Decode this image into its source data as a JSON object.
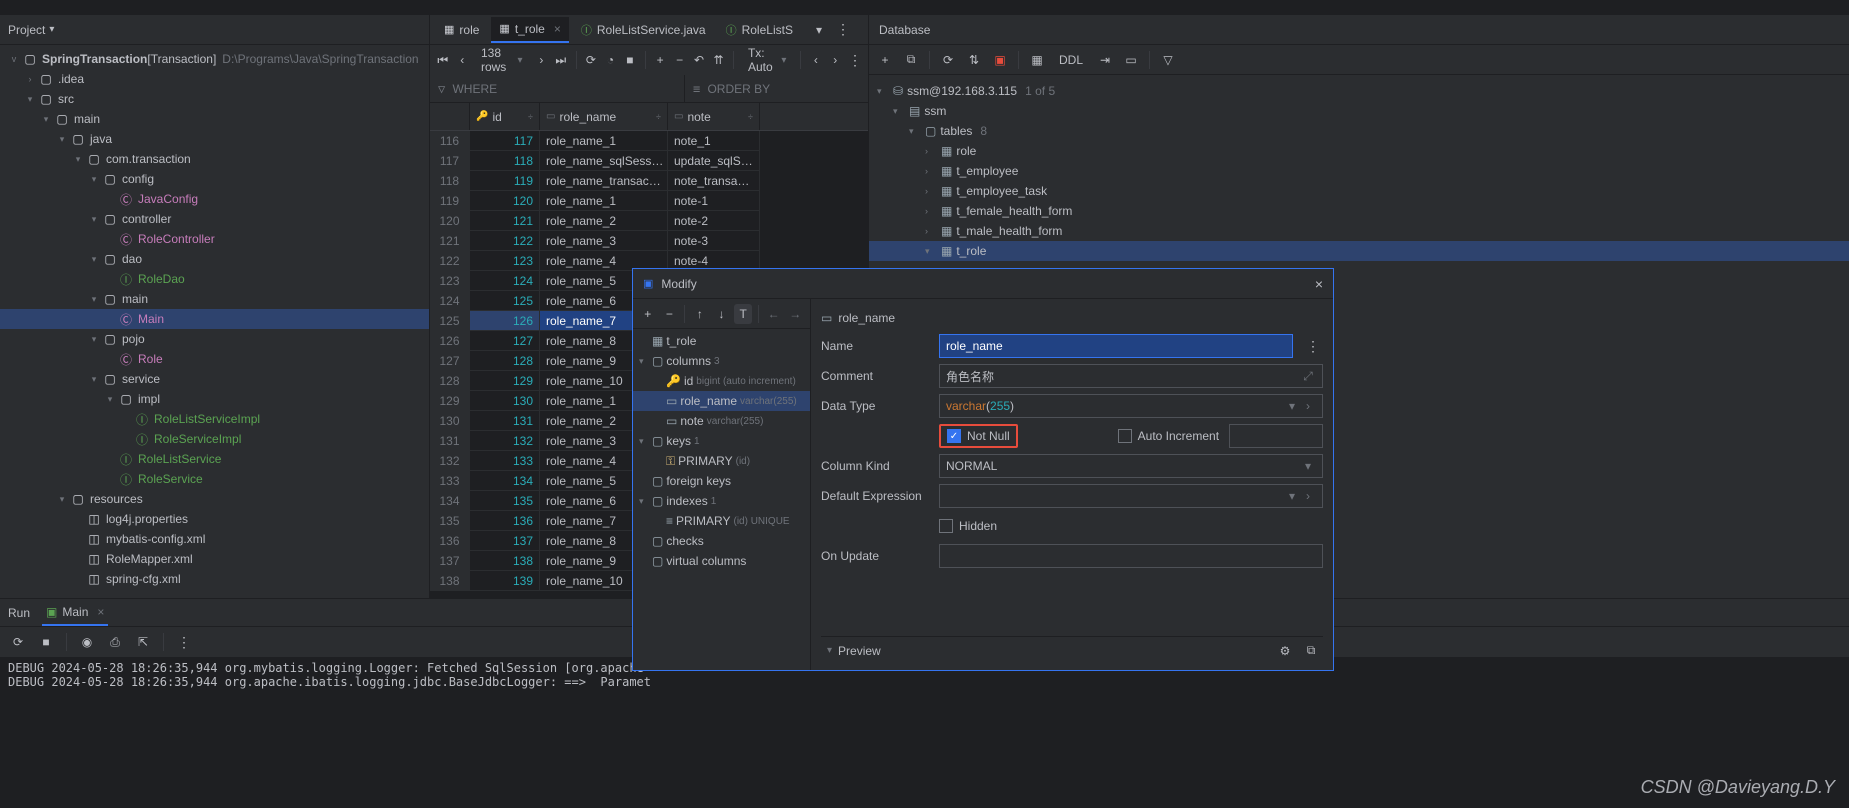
{
  "project": {
    "label": "Project",
    "root": {
      "name": "SpringTransaction",
      "scope": "[Transaction]",
      "path": "D:\\Programs\\Java\\SpringTransaction"
    },
    "tree": [
      {
        "d": 1,
        "ic": "folder",
        "name": ".idea",
        "tw": "›"
      },
      {
        "d": 1,
        "ic": "folder",
        "name": "src",
        "tw": "v"
      },
      {
        "d": 2,
        "ic": "folder",
        "name": "main",
        "tw": "v"
      },
      {
        "d": 3,
        "ic": "folder",
        "name": "java",
        "tw": "v"
      },
      {
        "d": 4,
        "ic": "folder",
        "name": "com.transaction",
        "tw": "v"
      },
      {
        "d": 5,
        "ic": "folder",
        "name": "config",
        "tw": "v"
      },
      {
        "d": 6,
        "ic": "java",
        "name": "JavaConfig"
      },
      {
        "d": 5,
        "ic": "folder",
        "name": "controller",
        "tw": "v"
      },
      {
        "d": 6,
        "ic": "java",
        "name": "RoleController"
      },
      {
        "d": 5,
        "ic": "folder",
        "name": "dao",
        "tw": "v"
      },
      {
        "d": 6,
        "ic": "if",
        "name": "RoleDao"
      },
      {
        "d": 5,
        "ic": "folder",
        "name": "main",
        "tw": "v"
      },
      {
        "d": 6,
        "ic": "java",
        "name": "Main",
        "sel": true
      },
      {
        "d": 5,
        "ic": "folder",
        "name": "pojo",
        "tw": "v"
      },
      {
        "d": 6,
        "ic": "java",
        "name": "Role"
      },
      {
        "d": 5,
        "ic": "folder",
        "name": "service",
        "tw": "v"
      },
      {
        "d": 6,
        "ic": "folder",
        "name": "impl",
        "tw": "v"
      },
      {
        "d": 7,
        "ic": "if",
        "name": "RoleListServiceImpl"
      },
      {
        "d": 7,
        "ic": "if",
        "name": "RoleServiceImpl"
      },
      {
        "d": 6,
        "ic": "if",
        "name": "RoleListService"
      },
      {
        "d": 6,
        "ic": "if",
        "name": "RoleService"
      },
      {
        "d": 3,
        "ic": "folder",
        "name": "resources",
        "tw": "v"
      },
      {
        "d": 4,
        "ic": "file",
        "name": "log4j.properties"
      },
      {
        "d": 4,
        "ic": "file",
        "name": "mybatis-config.xml"
      },
      {
        "d": 4,
        "ic": "file",
        "name": "RoleMapper.xml"
      },
      {
        "d": 4,
        "ic": "file",
        "name": "spring-cfg.xml"
      }
    ]
  },
  "tabs": [
    {
      "ic": "table",
      "label": "role"
    },
    {
      "ic": "table",
      "label": "t_role",
      "close": true,
      "active": true
    },
    {
      "ic": "java",
      "label": "RoleListService.java"
    },
    {
      "ic": "java",
      "label": "RoleListS"
    }
  ],
  "toolbar": {
    "rows": "138 rows",
    "tx": "Tx: Auto"
  },
  "filter": {
    "where": "WHERE",
    "order": "ORDER BY"
  },
  "columns": {
    "id": "id",
    "role_name": "role_name",
    "note": "note"
  },
  "table_rows": [
    {
      "n": "116",
      "id": "117",
      "r": "role_name_1",
      "note": "note_1"
    },
    {
      "n": "117",
      "id": "118",
      "r": "role_name_sqlSess…",
      "note": "update_sqlS…"
    },
    {
      "n": "118",
      "id": "119",
      "r": "role_name_transac…",
      "note": "note_transa…"
    },
    {
      "n": "119",
      "id": "120",
      "r": "role_name_1",
      "note": "note-1"
    },
    {
      "n": "120",
      "id": "121",
      "r": "role_name_2",
      "note": "note-2"
    },
    {
      "n": "121",
      "id": "122",
      "r": "role_name_3",
      "note": "note-3"
    },
    {
      "n": "122",
      "id": "123",
      "r": "role_name_4",
      "note": "note-4"
    },
    {
      "n": "123",
      "id": "124",
      "r": "role_name_5",
      "note": ""
    },
    {
      "n": "124",
      "id": "125",
      "r": "role_name_6",
      "note": ""
    },
    {
      "n": "125",
      "id": "126",
      "r": "role_name_7",
      "note": "",
      "sel": true
    },
    {
      "n": "126",
      "id": "127",
      "r": "role_name_8",
      "note": ""
    },
    {
      "n": "127",
      "id": "128",
      "r": "role_name_9",
      "note": ""
    },
    {
      "n": "128",
      "id": "129",
      "r": "role_name_10",
      "note": ""
    },
    {
      "n": "129",
      "id": "130",
      "r": "role_name_1",
      "note": ""
    },
    {
      "n": "130",
      "id": "131",
      "r": "role_name_2",
      "note": ""
    },
    {
      "n": "131",
      "id": "132",
      "r": "role_name_3",
      "note": ""
    },
    {
      "n": "132",
      "id": "133",
      "r": "role_name_4",
      "note": ""
    },
    {
      "n": "133",
      "id": "134",
      "r": "role_name_5",
      "note": ""
    },
    {
      "n": "134",
      "id": "135",
      "r": "role_name_6",
      "note": ""
    },
    {
      "n": "135",
      "id": "136",
      "r": "role_name_7",
      "note": ""
    },
    {
      "n": "136",
      "id": "137",
      "r": "role_name_8",
      "note": ""
    },
    {
      "n": "137",
      "id": "138",
      "r": "role_name_9",
      "note": ""
    },
    {
      "n": "138",
      "id": "139",
      "r": "role_name_10",
      "note": ""
    }
  ],
  "db": {
    "title": "Database",
    "ddl": "DDL",
    "conn": "ssm@192.168.3.115",
    "conn_cnt": "1 of 5",
    "schema": "ssm",
    "tables_lbl": "tables",
    "tables_cnt": "8",
    "tables": [
      "role",
      "t_employee",
      "t_employee_task",
      "t_female_health_form",
      "t_male_health_form",
      "t_role"
    ]
  },
  "dialog": {
    "title": "Modify",
    "crumb": "role_name",
    "left_root": "t_role",
    "sections": {
      "columns": {
        "label": "columns",
        "cnt": "3"
      },
      "id": {
        "name": "id",
        "type": "bigint (auto increment)"
      },
      "role_name": {
        "name": "role_name",
        "type": "varchar(255)"
      },
      "note": {
        "name": "note",
        "type": "varchar(255)"
      },
      "keys": {
        "label": "keys",
        "cnt": "1"
      },
      "primary": {
        "name": "PRIMARY",
        "meta": "(id)"
      },
      "fk": {
        "label": "foreign keys"
      },
      "indexes": {
        "label": "indexes",
        "cnt": "1"
      },
      "idx_primary": {
        "name": "PRIMARY",
        "meta": "(id) UNIQUE"
      },
      "checks": {
        "label": "checks"
      },
      "virtual": {
        "label": "virtual columns"
      }
    },
    "form": {
      "name_lbl": "Name",
      "name": "role_name",
      "comment_lbl": "Comment",
      "comment": "角色名称",
      "dtype_lbl": "Data Type",
      "dtype_kw": "varchar",
      "dtype_num": "255",
      "notnull": "Not Null",
      "autoinc": "Auto Increment",
      "kind_lbl": "Column Kind",
      "kind": "NORMAL",
      "def_lbl": "Default Expression",
      "hidden": "Hidden",
      "onupd_lbl": "On Update"
    },
    "preview": "Preview"
  },
  "run": {
    "label": "Run",
    "tab": "Main",
    "lines": [
      "DEBUG 2024-05-28 18:26:35,944 org.mybatis.logging.Logger: Fetched SqlSession [org.apache",
      "DEBUG 2024-05-28 18:26:35,944 org.apache.ibatis.logging.jdbc.BaseJdbcLogger: ==>  Paramet"
    ]
  },
  "watermark": "CSDN @Davieyang.D.Y"
}
